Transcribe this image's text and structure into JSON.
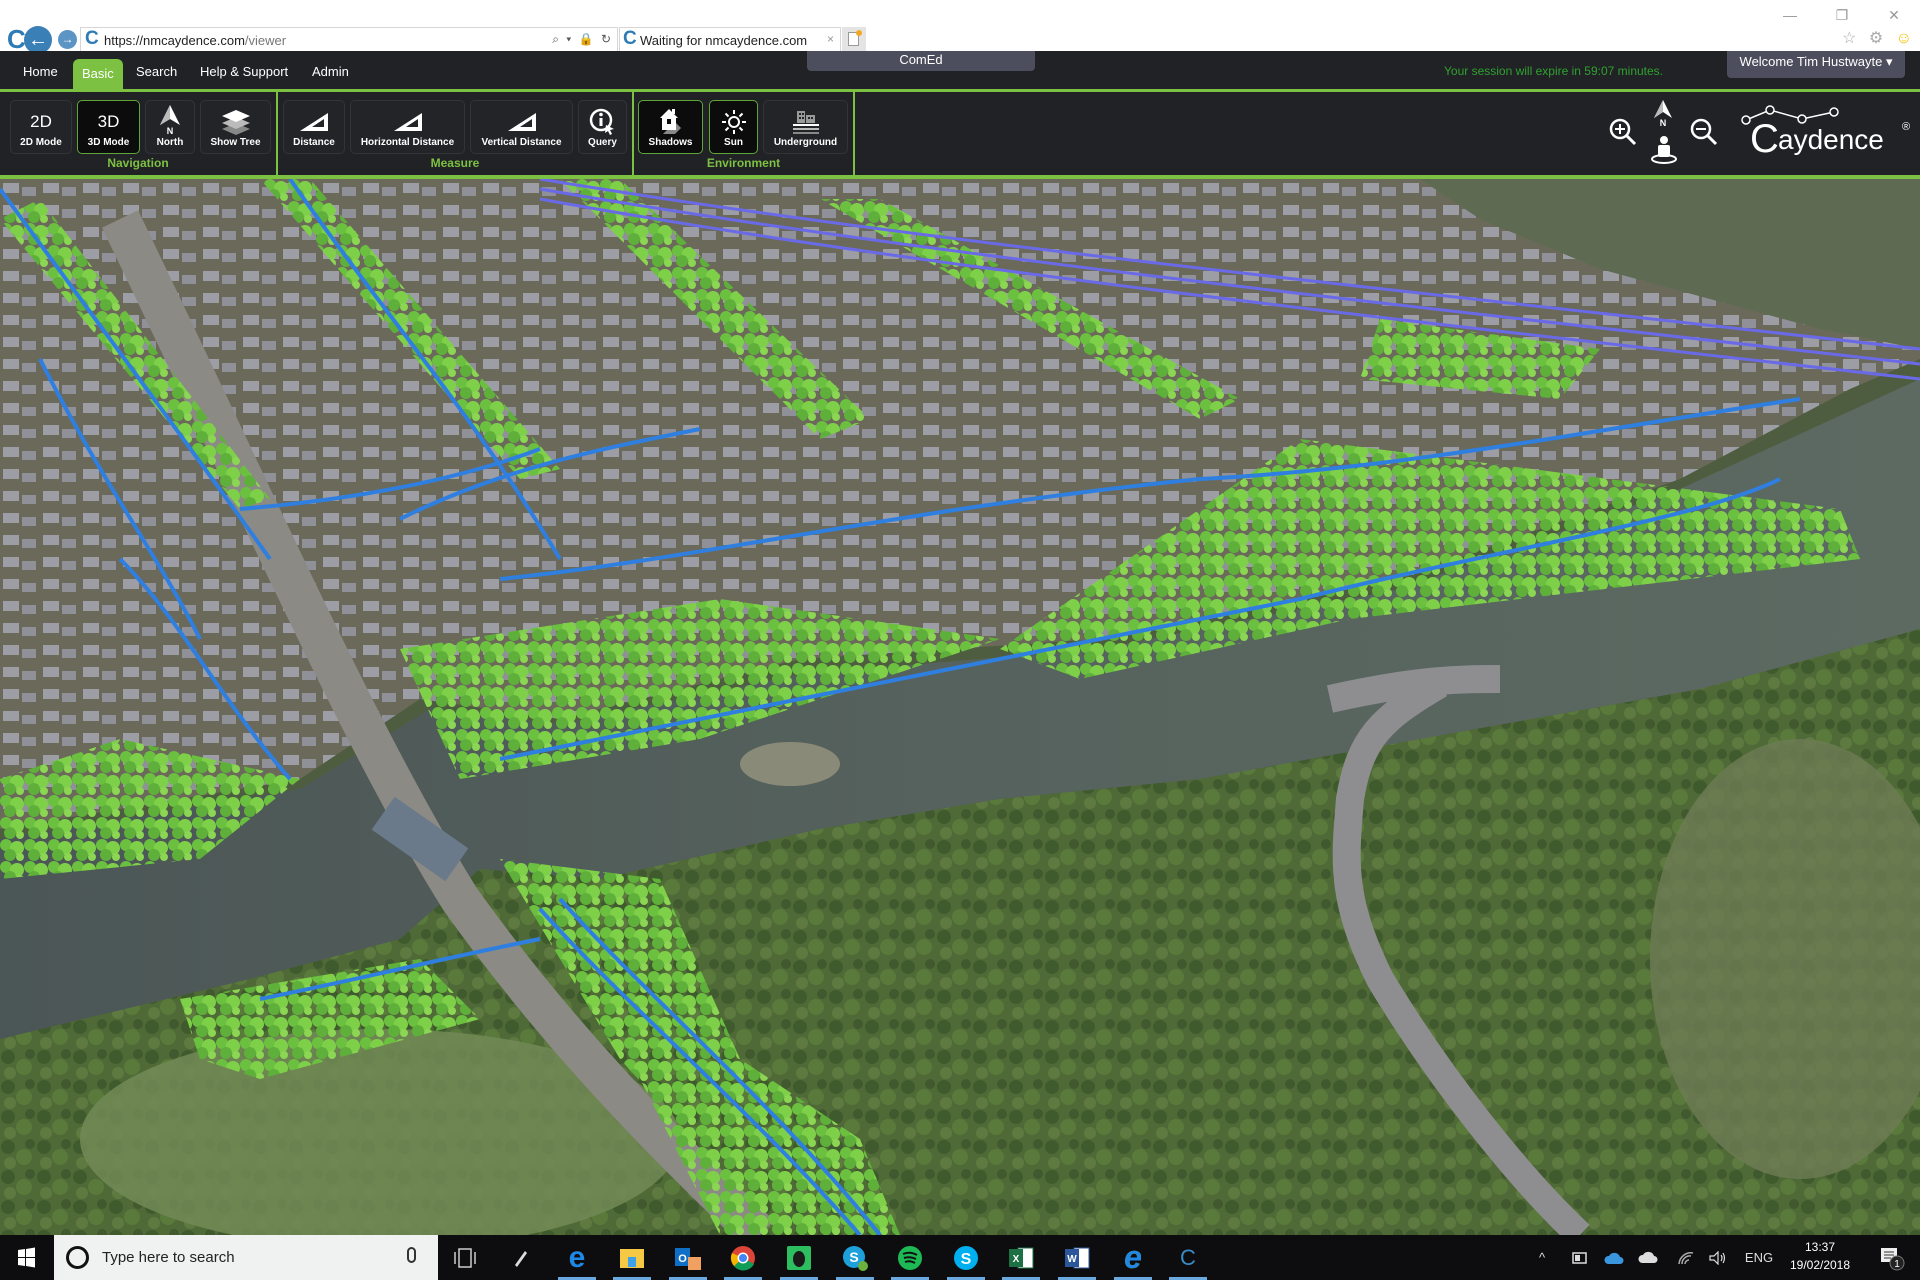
{
  "browser": {
    "url_host": "https://nmcaydence.com",
    "url_path": "/viewer",
    "tab_title": "Waiting for nmcaydence.com",
    "tab_close": "×",
    "window_controls": {
      "minimize": "—",
      "restore": "❐",
      "close": "✕"
    },
    "icons": {
      "favorites": "☆",
      "settings": "⚙",
      "feedback": "☺"
    },
    "address_tools": "⌕ ▾ 🔒 ↻"
  },
  "app": {
    "menu": [
      {
        "label": "Home",
        "active": false
      },
      {
        "label": "Basic",
        "active": true
      },
      {
        "label": "Search",
        "active": false
      },
      {
        "label": "Help & Support",
        "active": false
      },
      {
        "label": "Admin",
        "active": false
      }
    ],
    "project": "ComEd",
    "session_message": "Your session will expire in 59:07 minutes.",
    "welcome": "Welcome Tim Hustwayte ▾",
    "brand": "Caydence",
    "brand_mark": "®",
    "colors": {
      "accent": "#7cc142",
      "bar": "#212226",
      "session_text": "#2fa12f",
      "panel": "#4c4e5e"
    }
  },
  "toolbar": {
    "groups": [
      {
        "label": "Navigation"
      },
      {
        "label": "Measure"
      },
      {
        "label": "Environment"
      }
    ],
    "buttons": {
      "mode2d": {
        "icon_text": "2D",
        "label": "2D Mode",
        "active": false
      },
      "mode3d": {
        "icon_text": "3D",
        "label": "3D Mode",
        "active": true
      },
      "north": {
        "label": "North",
        "active": false
      },
      "show_tree": {
        "label": "Show Tree",
        "active": false
      },
      "distance": {
        "label": "Distance",
        "active": false
      },
      "horizontal_distance": {
        "label": "Horizontal Distance",
        "active": false
      },
      "vertical_distance": {
        "label": "Vertical Distance",
        "active": false
      },
      "query": {
        "label": "Query",
        "active": false
      },
      "shadows": {
        "label": "Shadows",
        "active": true
      },
      "sun": {
        "label": "Sun",
        "active": true
      },
      "underground": {
        "label": "Underground",
        "active": false
      }
    },
    "compass_letter": "N"
  },
  "map": {
    "description": "3D aerial view with LiDAR point-cloud vegetation (green), buildings (grey) and power lines (blue) along a river"
  },
  "taskbar": {
    "search_placeholder": "Type here to search",
    "apps": [
      "Task View",
      "Pen",
      "Edge",
      "File Explorer",
      "Outlook",
      "Chrome",
      "Evernote",
      "Skype for Business",
      "Spotify",
      "Skype",
      "Excel",
      "Word",
      "Internet Explorer",
      "Caydence"
    ],
    "tray": {
      "chevron": "^",
      "language": "ENG",
      "notifications_count": "1"
    },
    "time": "13:37",
    "date": "19/02/2018"
  }
}
